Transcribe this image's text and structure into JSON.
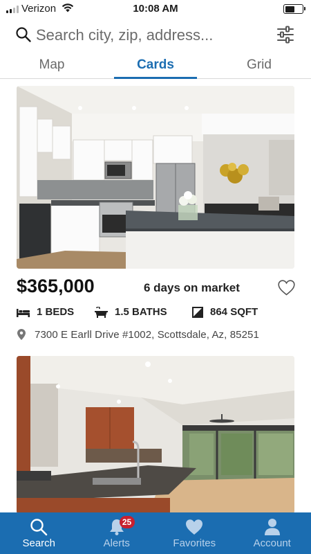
{
  "status": {
    "carrier": "Verizon",
    "time": "10:08 AM",
    "battery_level": 0.55
  },
  "search": {
    "placeholder": "Search city, zip, address...",
    "icon": "search-icon",
    "filter_icon": "sliders-icon"
  },
  "tabs": [
    {
      "label": "Map",
      "active": false
    },
    {
      "label": "Cards",
      "active": true
    },
    {
      "label": "Grid",
      "active": false
    }
  ],
  "listings": [
    {
      "price": "$365,000",
      "days_on_market": "6 days on market",
      "beds": "1 BEDS",
      "baths": "1.5 BATHS",
      "sqft": "864 SQFT",
      "address": "7300 E Earll Drive #1002, Scottsdale, Az, 85251",
      "favorited": false
    }
  ],
  "tab_bar": {
    "items": [
      {
        "label": "Search",
        "icon": "search-icon",
        "active": true
      },
      {
        "label": "Alerts",
        "icon": "bell-icon",
        "active": false,
        "badge": "25"
      },
      {
        "label": "Favorites",
        "icon": "heart-icon",
        "active": false
      },
      {
        "label": "Account",
        "icon": "person-icon",
        "active": false
      }
    ]
  },
  "colors": {
    "brand_blue": "#1b6db1",
    "badge_red": "#c8202f",
    "tab_inactive_label": "#b8d1ea"
  }
}
